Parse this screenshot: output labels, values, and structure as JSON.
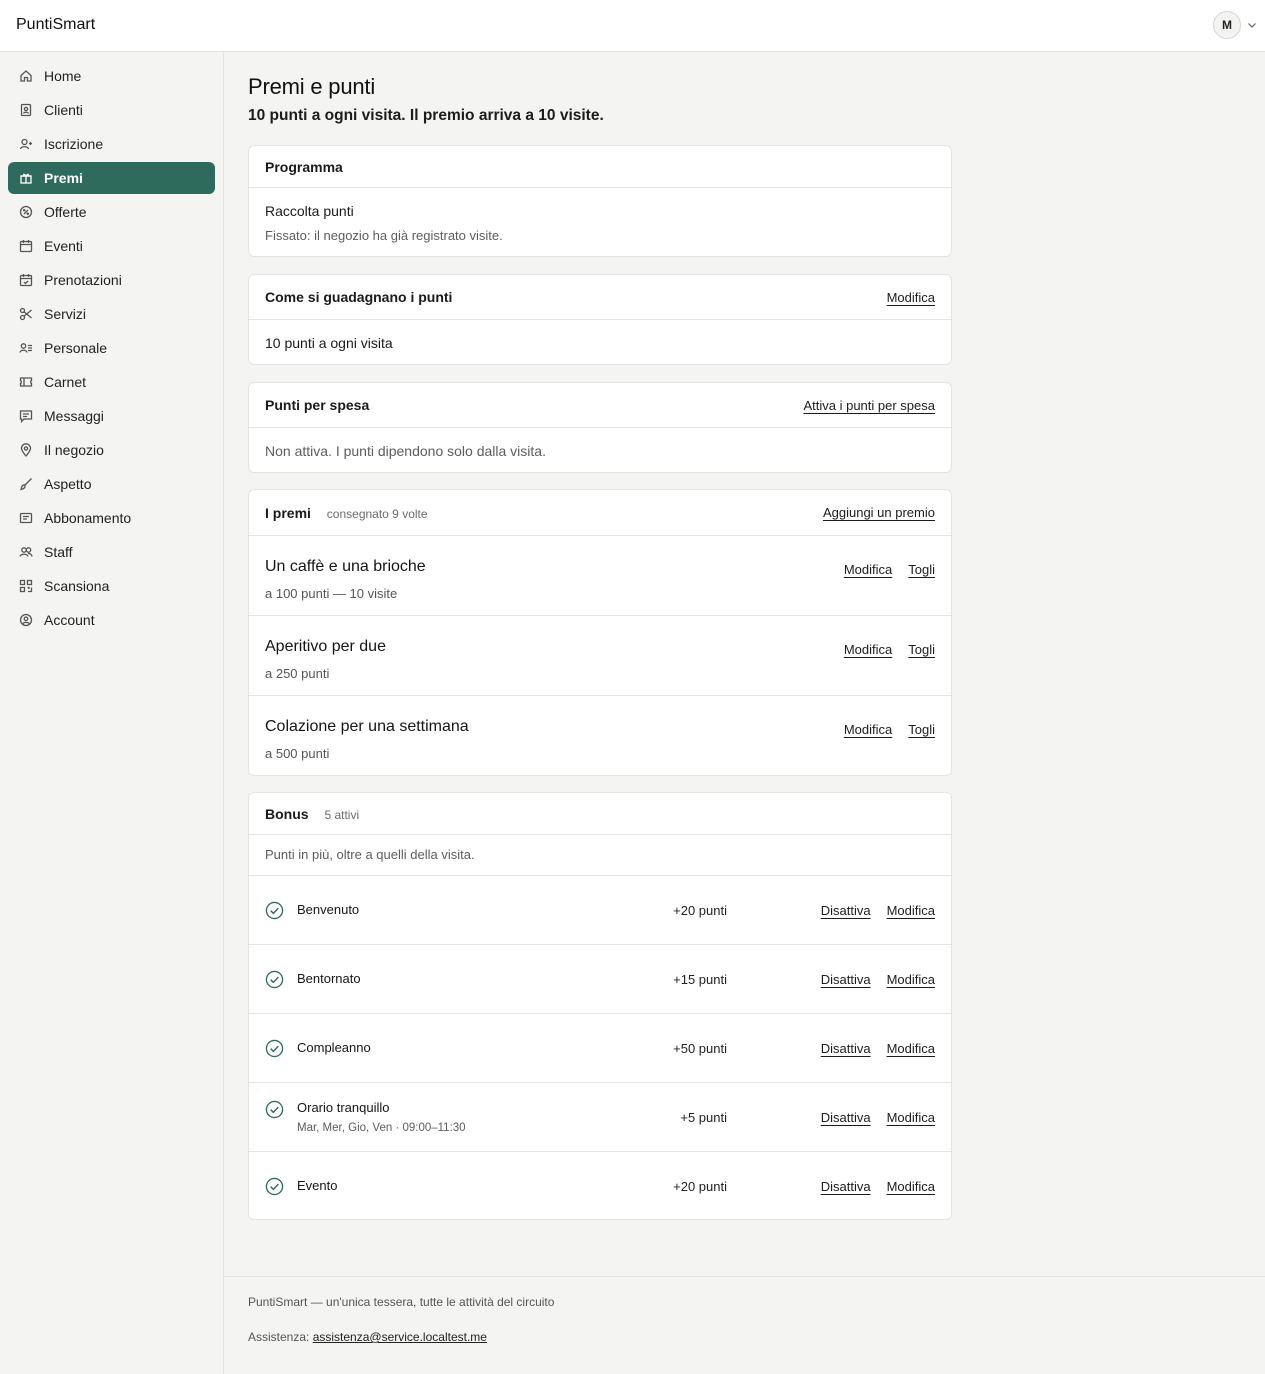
{
  "app": {
    "brand": "PuntiSmart",
    "avatar_initial": "M"
  },
  "sidebar": {
    "items": [
      {
        "label": "Home",
        "icon": "home-icon"
      },
      {
        "label": "Clienti",
        "icon": "contacts-icon"
      },
      {
        "label": "Iscrizione",
        "icon": "user-plus-icon"
      },
      {
        "label": "Premi",
        "icon": "gift-icon",
        "active": true
      },
      {
        "label": "Offerte",
        "icon": "percent-badge-icon"
      },
      {
        "label": "Eventi",
        "icon": "calendar-icon"
      },
      {
        "label": "Prenotazioni",
        "icon": "calendar-check-icon"
      },
      {
        "label": "Servizi",
        "icon": "scissors-icon"
      },
      {
        "label": "Personale",
        "icon": "user-list-icon"
      },
      {
        "label": "Carnet",
        "icon": "ticket-icon"
      },
      {
        "label": "Messaggi",
        "icon": "message-icon"
      },
      {
        "label": "Il negozio",
        "icon": "map-pin-icon"
      },
      {
        "label": "Aspetto",
        "icon": "brush-icon"
      },
      {
        "label": "Abbonamento",
        "icon": "receipt-icon"
      },
      {
        "label": "Staff",
        "icon": "users-icon"
      },
      {
        "label": "Scansiona",
        "icon": "qr-code-icon"
      },
      {
        "label": "Account",
        "icon": "user-circle-icon"
      }
    ]
  },
  "page": {
    "title": "Premi e punti",
    "subtitle": "10 punti a ogni visita. Il premio arriva a 10 visite."
  },
  "program": {
    "header": "Programma",
    "name": "Raccolta punti",
    "note": "Fissato: il negozio ha già registrato visite."
  },
  "earning": {
    "header": "Come si guadagnano i punti",
    "action": "Modifica",
    "text": "10 punti a ogni visita"
  },
  "spend": {
    "header": "Punti per spesa",
    "action": "Attiva i punti per spesa",
    "text": "Non attiva. I punti dipendono solo dalla visita."
  },
  "rewards": {
    "header": "I premi",
    "meta": "consegnato 9 volte",
    "action": "Aggiungi un premio",
    "edit_label": "Modifica",
    "remove_label": "Togli",
    "items": [
      {
        "name": "Un caffè e una brioche",
        "points": "a 100 punti — 10 visite"
      },
      {
        "name": "Aperitivo per due",
        "points": "a 250 punti"
      },
      {
        "name": "Colazione per una settimana",
        "points": "a 500 punti"
      }
    ]
  },
  "bonus": {
    "header": "Bonus",
    "meta": "5 attivi",
    "intro": "Punti in più, oltre a quelli della visita.",
    "disable_label": "Disattiva",
    "edit_label": "Modifica",
    "accent": "#2f6b5c",
    "items": [
      {
        "name": "Benvenuto",
        "detail": "",
        "points": "+20 punti"
      },
      {
        "name": "Bentornato",
        "detail": "",
        "points": "+15 punti"
      },
      {
        "name": "Compleanno",
        "detail": "",
        "points": "+50 punti"
      },
      {
        "name": "Orario tranquillo",
        "detail": "Mar, Mer, Gio, Ven · 09:00–11:30",
        "points": "+5 punti"
      },
      {
        "name": "Evento",
        "detail": "",
        "points": "+20 punti"
      }
    ]
  },
  "footer": {
    "tagline": "PuntiSmart — un'unica tessera, tutte le attività del circuito",
    "support_label": "Assistenza:",
    "support_email": "assistenza@service.localtest.me"
  }
}
